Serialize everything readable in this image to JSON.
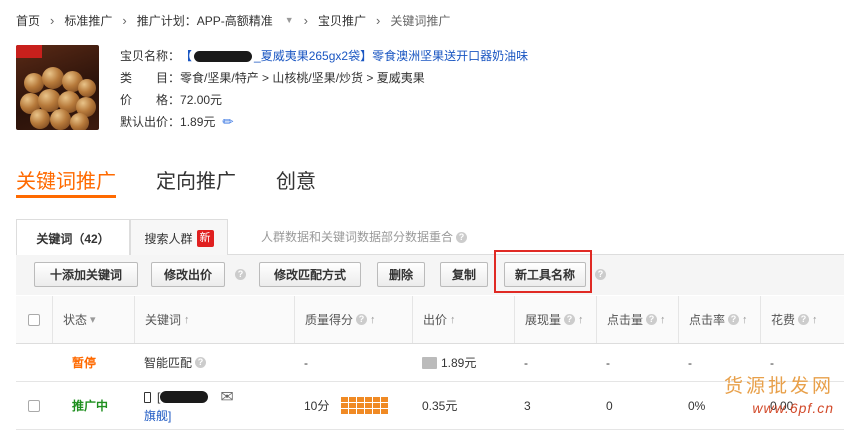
{
  "breadcrumb": {
    "items": [
      "首页",
      "标准推广",
      "推广计划：APP-高额精准",
      "宝贝推广",
      "关键词推广"
    ],
    "dropdown_icon": "chevron-down-icon"
  },
  "product": {
    "name_label": "宝贝名称：",
    "name_prefix": "【",
    "name_value": "_夏威夷果265gx2袋】零食澳洲坚果送开口器奶油味",
    "category_label": "类",
    "category_label2": "目：",
    "category_value": "零食/坚果/特产 > 山核桃/坚果/炒货 > 夏威夷果",
    "price_label": "价",
    "price_label2": "格：",
    "price_value": "72.00元",
    "default_bid_label": "默认出价：",
    "default_bid_value": "1.89元",
    "edit_icon": "pencil-icon"
  },
  "main_tabs": [
    "关键词推广",
    "定向推广",
    "创意"
  ],
  "sub_tabs": {
    "keyword_tab": "关键词（42）",
    "crowd_tab": "搜索人群",
    "new_badge": "新",
    "note": "人群数据和关键词数据部分数据重合"
  },
  "toolbar": {
    "add_keyword": "十添加关键词",
    "modify_bid": "修改出价",
    "modify_match": "修改匹配方式",
    "delete": "删除",
    "copy": "复制",
    "new_tool": "新工具名称"
  },
  "table": {
    "headers": [
      "状态",
      "关键词",
      "质量得分",
      "出价",
      "展现量",
      "点击量",
      "点击率",
      "花费"
    ],
    "rows": [
      {
        "status": "暂停",
        "keyword": "智能匹配",
        "quality": "-",
        "bid": "1.89元",
        "impressions": "-",
        "clicks": "-",
        "ctr": "-",
        "cost": "-"
      },
      {
        "status": "推广中",
        "keyword_prefix": "[",
        "keyword_suffix": "旗舰]",
        "quality": "10分",
        "bid": "0.35元",
        "impressions": "3",
        "clicks": "0",
        "ctr": "0%",
        "cost": "0.00"
      }
    ]
  },
  "watermark": {
    "line1": "货源批发网",
    "line2": "www.6pf.cn"
  },
  "colors": {
    "accent": "#ff6a00",
    "link": "#1a56c2",
    "status_active": "#1f8f1f",
    "highlight_box": "#e02a24",
    "new_badge": "#e02020"
  }
}
